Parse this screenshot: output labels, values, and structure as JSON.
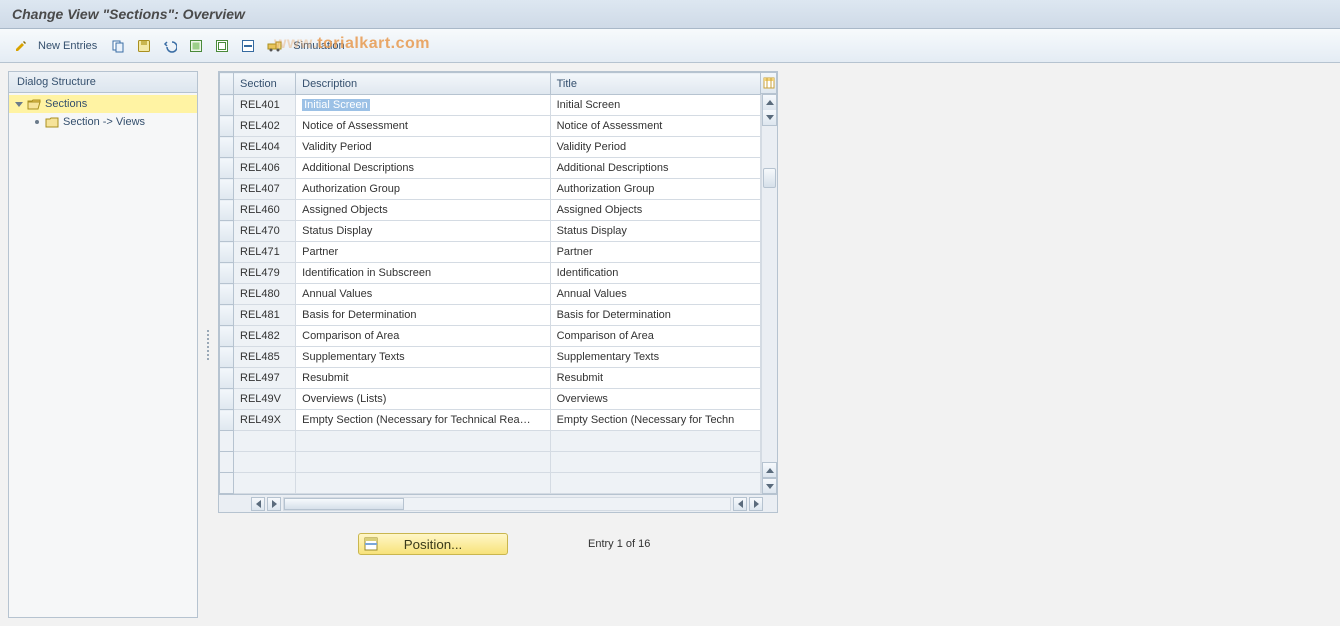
{
  "titlebar": {
    "title": "Change View \"Sections\": Overview"
  },
  "toolbar": {
    "new_entries_label": "New Entries",
    "simulation_label": "Simulation",
    "icons": {
      "pencil": "toggle-change-icon",
      "copy": "copy-icon",
      "save": "save-icon",
      "undo": "undo-icon",
      "select_all": "select-all-icon",
      "deselect_all": "deselect-all-icon",
      "delete": "delete-icon",
      "transport": "transport-icon"
    }
  },
  "watermark": {
    "left": "www.",
    "mid": "torialkart",
    "right": ".com"
  },
  "tree": {
    "header": "Dialog Structure",
    "items": [
      {
        "label": "Sections",
        "level": 1,
        "open": true,
        "selected": true
      },
      {
        "label": "Section -> Views",
        "level": 2,
        "open": false,
        "selected": false
      }
    ]
  },
  "grid": {
    "columns": [
      "Section",
      "Description",
      "Title"
    ],
    "rows": [
      {
        "section": "REL401",
        "description": "Initial Screen",
        "title": "Initial Screen",
        "selected": true
      },
      {
        "section": "REL402",
        "description": "Notice of Assessment",
        "title": "Notice of Assessment"
      },
      {
        "section": "REL404",
        "description": "Validity Period",
        "title": "Validity Period"
      },
      {
        "section": "REL406",
        "description": "Additional Descriptions",
        "title": "Additional Descriptions"
      },
      {
        "section": "REL407",
        "description": "Authorization Group",
        "title": "Authorization Group"
      },
      {
        "section": "REL460",
        "description": "Assigned Objects",
        "title": "Assigned Objects"
      },
      {
        "section": "REL470",
        "description": "Status Display",
        "title": "Status Display"
      },
      {
        "section": "REL471",
        "description": "Partner",
        "title": "Partner"
      },
      {
        "section": "REL479",
        "description": "Identification in Subscreen",
        "title": "Identification"
      },
      {
        "section": "REL480",
        "description": "Annual Values",
        "title": "Annual Values"
      },
      {
        "section": "REL481",
        "description": "Basis for Determination",
        "title": "Basis for Determination"
      },
      {
        "section": "REL482",
        "description": "Comparison of Area",
        "title": "Comparison of Area"
      },
      {
        "section": "REL485",
        "description": "Supplementary Texts",
        "title": "Supplementary Texts"
      },
      {
        "section": "REL497",
        "description": "Resubmit",
        "title": "Resubmit"
      },
      {
        "section": "REL49V",
        "description": "Overviews (Lists)",
        "title": "Overviews"
      },
      {
        "section": "REL49X",
        "description": "Empty Section (Necessary for Technical Rea…",
        "title": "Empty Section (Necessary for Techn"
      }
    ],
    "empty_rows": 3
  },
  "footer": {
    "position_label": "Position...",
    "entry_label": "Entry 1 of 16"
  }
}
